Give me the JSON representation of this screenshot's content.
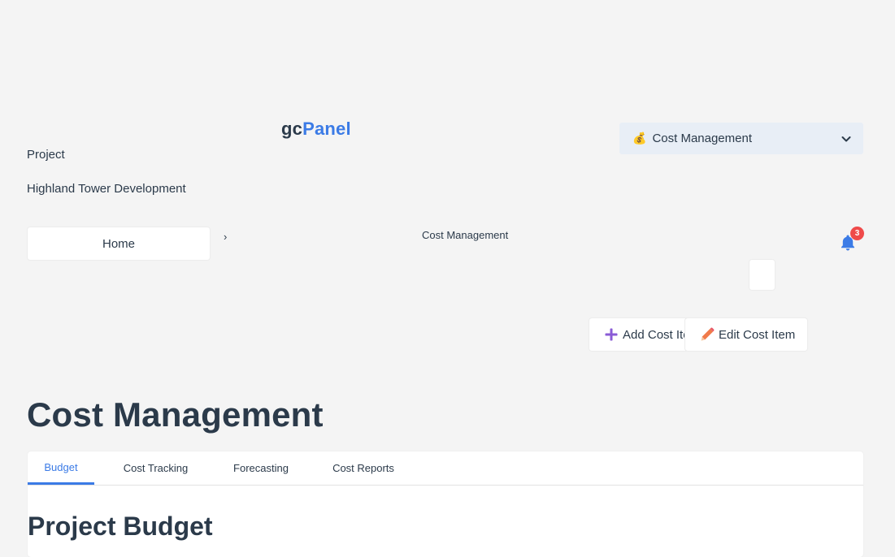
{
  "logo": {
    "prefix": "gc",
    "suffix": "Panel"
  },
  "module_select": {
    "emoji": "💰",
    "selected": "Cost Management"
  },
  "project": {
    "label": "Project",
    "name": "Highland Tower Development"
  },
  "breadcrumb": {
    "home": "Home",
    "separator": "›",
    "current": "Cost Management"
  },
  "notifications": {
    "count": "3"
  },
  "actions": {
    "add_label": "Add Cost Item",
    "edit_label": "Edit Cost Item"
  },
  "page": {
    "title": "Cost Management",
    "section_title": "Project Budget"
  },
  "tabs": [
    {
      "label": "Budget",
      "active": true
    },
    {
      "label": "Cost Tracking",
      "active": false
    },
    {
      "label": "Forecasting",
      "active": false
    },
    {
      "label": "Cost Reports",
      "active": false
    }
  ],
  "colors": {
    "background": "#f4f4f4",
    "accent": "#3b7be6",
    "text": "#2b3a4a",
    "badge": "#ef4a4a",
    "dropdown_bg": "#e8eef6"
  }
}
